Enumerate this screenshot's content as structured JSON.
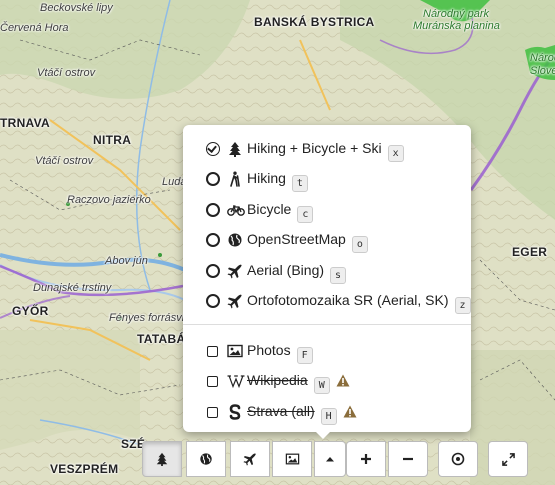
{
  "map": {
    "places": [
      {
        "id": "beckovske-lipy",
        "text": "Beckovské lipy",
        "cls": ""
      },
      {
        "id": "cervena-hora",
        "text": "Červená Hora",
        "cls": ""
      },
      {
        "id": "banska-bystrica",
        "text": "BANSKÁ BYSTRICA",
        "cls": "city"
      },
      {
        "id": "narodny-park",
        "text": "Národný park",
        "cls": "park"
      },
      {
        "id": "muranska-planina",
        "text": "Muránska planina",
        "cls": "park"
      },
      {
        "id": "narodny-park-slovensky",
        "text": "Národ",
        "cls": "park"
      },
      {
        "id": "slovensky",
        "text": "Slove",
        "cls": "park"
      },
      {
        "id": "vtacil-ostrov-1",
        "text": "Vtáčí ostrov",
        "cls": ""
      },
      {
        "id": "trnava",
        "text": "TRNAVA",
        "cls": "city"
      },
      {
        "id": "nitra",
        "text": "NITRA",
        "cls": "city"
      },
      {
        "id": "vtacil-ostrov-2",
        "text": "Vtáčí ostrov",
        "cls": ""
      },
      {
        "id": "raczova-jazierka",
        "text": "Raczovo jazierko",
        "cls": ""
      },
      {
        "id": "ludanice",
        "text": "Ludan",
        "cls": ""
      },
      {
        "id": "abov-jun",
        "text": "Abov jún",
        "cls": ""
      },
      {
        "id": "dunajske-trstiny",
        "text": "Dunajské trstiny",
        "cls": ""
      },
      {
        "id": "gyor",
        "text": "GYŐR",
        "cls": "city"
      },
      {
        "id": "fenyes",
        "text": "Fényes forrásvid",
        "cls": ""
      },
      {
        "id": "tatabanya",
        "text": "TATABÁN",
        "cls": "city"
      },
      {
        "id": "eger",
        "text": "EGER",
        "cls": "city"
      },
      {
        "id": "szekes",
        "text": "SZÉ",
        "cls": "city"
      },
      {
        "id": "veszprem",
        "text": "VESZPRÉM",
        "cls": "city"
      }
    ]
  },
  "layer_menu": {
    "base_layers": [
      {
        "id": "hiking-bicycle-ski",
        "label": "Hiking + Bicycle + Ski",
        "key": "x",
        "icon": "tree-icon",
        "checked": true
      },
      {
        "id": "hiking",
        "label": "Hiking",
        "key": "t",
        "icon": "hiker-icon",
        "checked": false
      },
      {
        "id": "bicycle",
        "label": "Bicycle",
        "key": "c",
        "icon": "bicycle-icon",
        "checked": false
      },
      {
        "id": "openstreetmap",
        "label": "OpenStreetMap",
        "key": "o",
        "icon": "globe-icon",
        "checked": false
      },
      {
        "id": "aerial-bing",
        "label": "Aerial (Bing)",
        "key": "s",
        "icon": "plane-icon",
        "checked": false
      },
      {
        "id": "ortofoto",
        "label": "Ortofotomozaika SR (Aerial, SK)",
        "key": "z",
        "icon": "plane-icon",
        "checked": false
      }
    ],
    "overlays": [
      {
        "id": "photos",
        "label": "Photos",
        "key": "F",
        "icon": "photo-icon",
        "strike": false,
        "warning": false
      },
      {
        "id": "wikipedia",
        "label": "Wikipedia",
        "key": "W",
        "icon": "wikipedia-icon",
        "strike": true,
        "warning": true
      },
      {
        "id": "strava",
        "label": "Strava (all)",
        "key": "H",
        "icon": "strava-icon",
        "strike": true,
        "warning": true
      }
    ]
  },
  "toolbar": {
    "buttons": [
      {
        "id": "tree",
        "icon": "tree-icon",
        "active": true
      },
      {
        "id": "globe",
        "icon": "globe-icon",
        "active": false
      },
      {
        "id": "plane",
        "icon": "plane-icon",
        "active": false
      },
      {
        "id": "photo",
        "icon": "photo-icon",
        "active": false
      },
      {
        "id": "caret",
        "icon": "caret-up-icon",
        "active": false
      },
      {
        "id": "zoom-in",
        "icon": "plus-icon",
        "active": false
      },
      {
        "id": "zoom-out",
        "icon": "minus-icon",
        "active": false
      },
      {
        "id": "locate",
        "icon": "locate-icon",
        "active": false
      },
      {
        "id": "fullscreen",
        "icon": "expand-icon",
        "active": false
      }
    ]
  },
  "colors": {
    "route_purple": "#8e58c8",
    "border_purple": "#9a5fd0",
    "forest_green": "#3fbf3f"
  }
}
